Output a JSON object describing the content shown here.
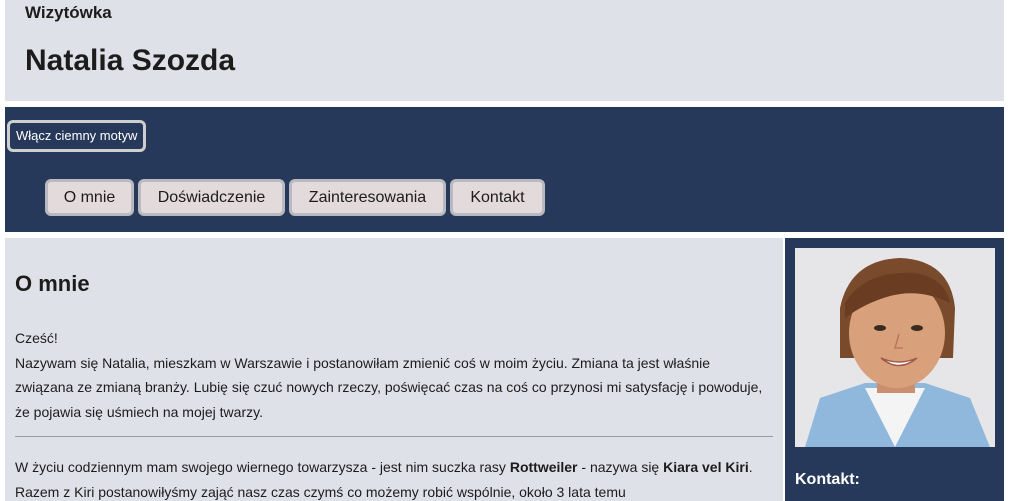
{
  "header": {
    "small_title": "Wizytówka",
    "big_title": "Natalia Szozda"
  },
  "nav": {
    "theme_button": "Włącz ciemny motyw",
    "tabs": [
      "O mnie",
      "Doświadczenie",
      "Zainteresowania",
      "Kontakt"
    ]
  },
  "main": {
    "heading": "O mnie",
    "p1_line1": "Cześć!",
    "p1_line2": "Nazywam się Natalia, mieszkam w Warszawie i postanowiłam zmienić coś w moim życiu. Zmiana ta jest właśnie związana ze zmianą branży. Lubię się czuć nowych rzeczy, poświęcać czas na coś co przynosi mi satysfację i powoduje, że pojawia się uśmiech na mojej twarzy.",
    "p2_a": "W życiu codziennym mam swojego wiernego towarzysza - jest nim suczka rasy ",
    "p2_b": "Rottweiler",
    "p2_c": " - nazywa się ",
    "p2_d": "Kiara vel Kiri",
    "p2_e": ". Razem z Kiri postanowiłyśmy zająć nasz czas czymś co możemy robić wspólnie, około 3 lata temu"
  },
  "side": {
    "title": "Kontakt:"
  },
  "colors": {
    "navy": "#27395a",
    "light": "#dfe1e8",
    "tab": "#e3dadb"
  }
}
